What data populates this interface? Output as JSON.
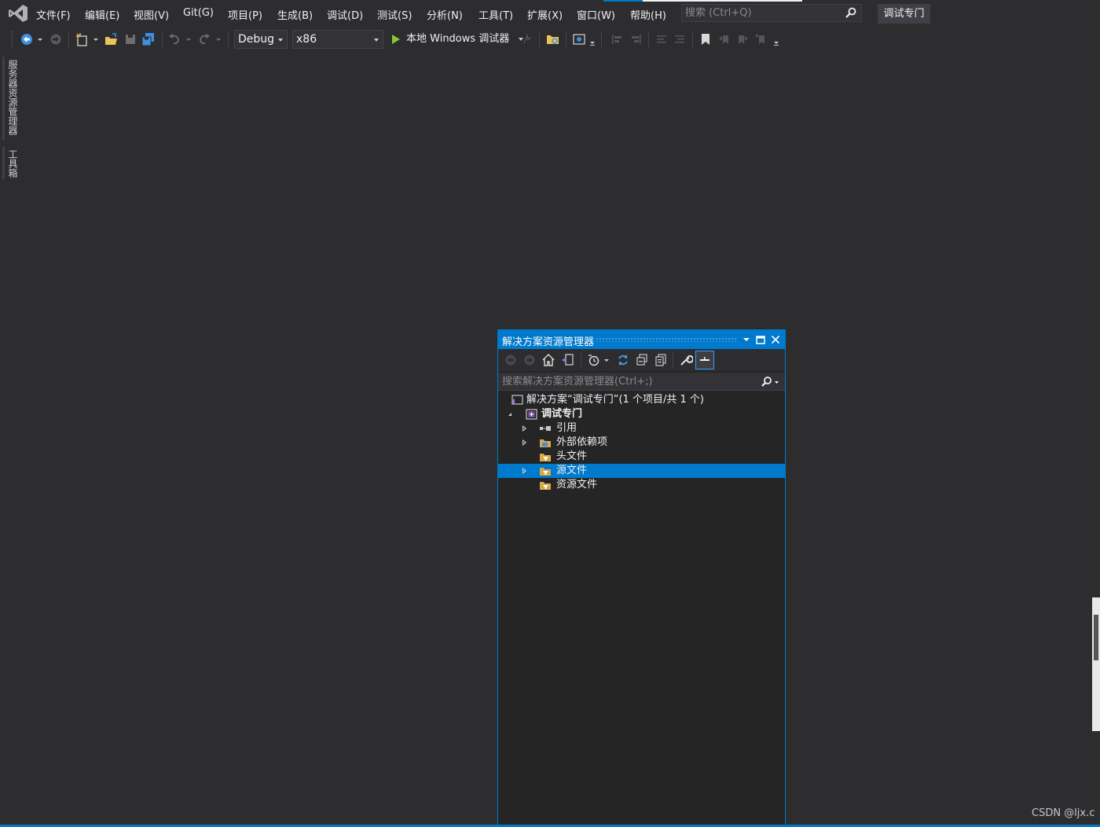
{
  "menubar": {
    "items": [
      {
        "label": "文件(F)"
      },
      {
        "label": "编辑(E)"
      },
      {
        "label": "视图(V)"
      },
      {
        "label": "Git(G)"
      },
      {
        "label": "项目(P)"
      },
      {
        "label": "生成(B)"
      },
      {
        "label": "调试(D)"
      },
      {
        "label": "测试(S)"
      },
      {
        "label": "分析(N)"
      },
      {
        "label": "工具(T)"
      },
      {
        "label": "扩展(X)"
      },
      {
        "label": "窗口(W)"
      },
      {
        "label": "帮助(H)"
      }
    ],
    "search_placeholder": "搜索 (Ctrl+Q)",
    "project_name": "调试专门"
  },
  "toolbar": {
    "configuration": "Debug",
    "platform": "x86",
    "run_label": "本地 Windows 调试器"
  },
  "side_tabs": [
    {
      "label": "服务器资源管理器"
    },
    {
      "label": "工具箱"
    }
  ],
  "solution_explorer": {
    "title": "解决方案资源管理器",
    "search_placeholder": "搜索解决方案资源管理器(Ctrl+;)",
    "tree": [
      {
        "label": "解决方案“调试专门”(1 个项目/共 1 个)",
        "icon": "solution-icon"
      },
      {
        "label": "调试专门",
        "icon": "cpp-project-icon",
        "expanded": true
      },
      {
        "label": "引用",
        "icon": "references-icon",
        "expandable": true
      },
      {
        "label": "外部依赖项",
        "icon": "external-deps-icon",
        "expandable": true
      },
      {
        "label": "头文件",
        "icon": "filter-folder-icon"
      },
      {
        "label": "源文件",
        "icon": "filter-folder-icon",
        "expandable": true,
        "selected": true
      },
      {
        "label": "资源文件",
        "icon": "filter-folder-icon"
      }
    ]
  },
  "watermark": "CSDN @ljx.c",
  "colors": {
    "background": "#2d2d30",
    "accent": "#007acc",
    "panel": "#252526",
    "run_green": "#8ac53d"
  }
}
